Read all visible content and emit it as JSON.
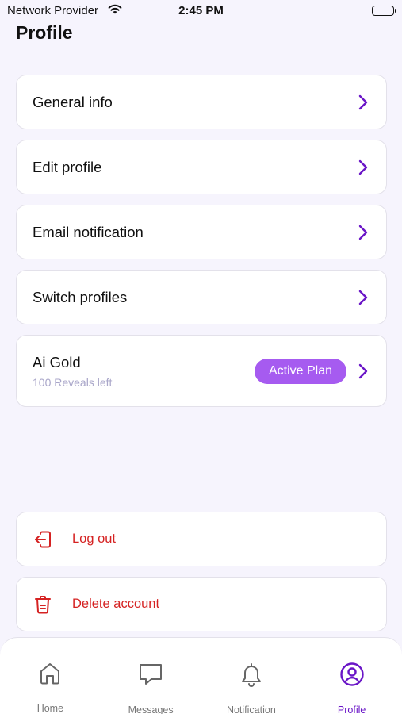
{
  "status_bar": {
    "carrier": "Network Provider",
    "time": "2:45 PM"
  },
  "page": {
    "title": "Profile"
  },
  "menu": [
    {
      "label": "General info",
      "icon": "chevron-right-icon"
    },
    {
      "label": "Edit profile",
      "icon": "chevron-right-icon"
    },
    {
      "label": "Email notification",
      "icon": "chevron-right-icon"
    },
    {
      "label": "Switch profiles",
      "icon": "chevron-right-icon"
    }
  ],
  "plan": {
    "title": "Ai Gold",
    "subtitle": "100 Reveals left",
    "badge": "Active Plan"
  },
  "account_actions": {
    "logout_label": "Log out",
    "delete_label": "Delete account"
  },
  "tabs": [
    {
      "label": "Home",
      "icon": "home-icon",
      "active": false
    },
    {
      "label": "Messages",
      "icon": "chat-bubble-icon",
      "active": false
    },
    {
      "label": "Notification",
      "icon": "bell-icon",
      "active": false
    },
    {
      "label": "Profile",
      "icon": "user-circle-icon",
      "active": true
    }
  ],
  "colors": {
    "accent": "#6a16c7",
    "badge": "#a65bf0",
    "danger": "#d52222",
    "background": "#f6f4fd",
    "card": "#ffffff",
    "muted": "#a9a6c9"
  }
}
